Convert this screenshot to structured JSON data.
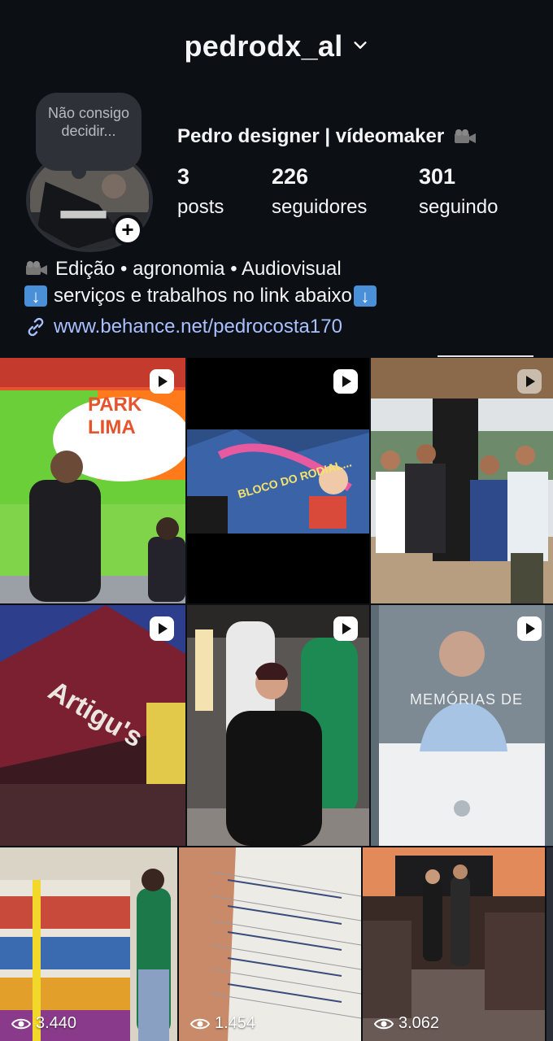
{
  "header": {
    "username": "pedrodx_al"
  },
  "note": {
    "text": "Não consigo decidir..."
  },
  "profile": {
    "display_name": "Pedro designer | vídeomaker",
    "stats": [
      {
        "value": "3",
        "label": "posts"
      },
      {
        "value": "226",
        "label": "seguidores"
      },
      {
        "value": "301",
        "label": "seguindo"
      }
    ],
    "bio_line_1": "Edição • agronomia • Audiovisual",
    "bio_line_2": "serviços e trabalhos no link abaixo",
    "link": "www.behance.net/pedrocosta170"
  },
  "grid": {
    "tiles": [
      {
        "type": "reel",
        "caption": "PARK LIMA"
      },
      {
        "type": "reel",
        "caption": "BLOCO DO RODIAL..."
      },
      {
        "type": "reel"
      },
      {
        "type": "reel",
        "caption": "Artigu's"
      },
      {
        "type": "reel"
      },
      {
        "type": "reel",
        "caption": "MEMÓRIAS DE"
      },
      {
        "type": "reel",
        "views": "3.440"
      },
      {
        "type": "reel",
        "views": "1.454"
      },
      {
        "type": "reel",
        "views": "3.062"
      }
    ]
  }
}
